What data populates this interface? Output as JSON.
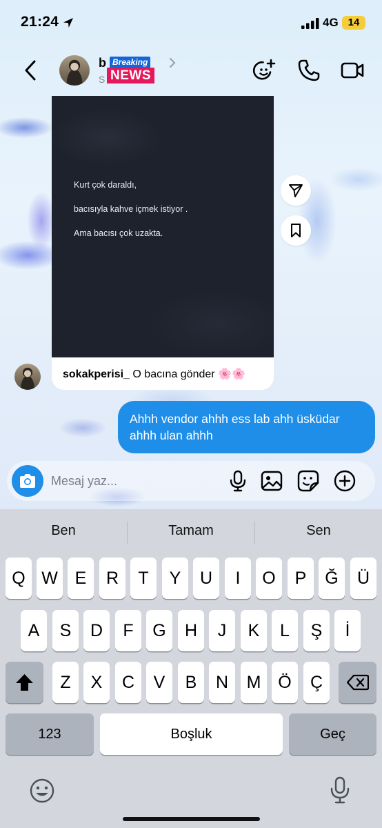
{
  "status_bar": {
    "time": "21:24",
    "network": "4G",
    "battery": "14"
  },
  "header": {
    "name_visible": "b kftr",
    "subtitle_visible": "S",
    "sticker_top": "Breaking",
    "sticker_bottom": "NEWS"
  },
  "post": {
    "lines": [
      "Kurt çok daraldı,",
      "bacısıyla kahve içmek istiyor .",
      "Ama bacısı çok uzakta."
    ],
    "caption_user": "sokakperisi_",
    "caption_text": "O bacına gönder",
    "caption_emoji": "🌸🌸"
  },
  "message_out": {
    "text": "Ahhh vendor ahhh ess lab ahh üsküdar ahhh ulan ahhh"
  },
  "composer": {
    "placeholder": "Mesaj yaz..."
  },
  "keyboard": {
    "suggestions": [
      "Ben",
      "Tamam",
      "Sen"
    ],
    "row1": [
      "Q",
      "W",
      "E",
      "R",
      "T",
      "Y",
      "U",
      "I",
      "O",
      "P",
      "Ğ",
      "Ü"
    ],
    "row2": [
      "A",
      "S",
      "D",
      "F",
      "G",
      "H",
      "J",
      "K",
      "L",
      "Ş",
      "İ"
    ],
    "row3": [
      "Z",
      "X",
      "C",
      "V",
      "B",
      "N",
      "M",
      "Ö",
      "Ç"
    ],
    "numbers_label": "123",
    "space_label": "Boşluk",
    "return_label": "Geç"
  },
  "colors": {
    "accent": "#1e8ee9",
    "battery": "#f5cd3b",
    "news_blue": "#1565d8",
    "news_red": "#e5185b"
  }
}
